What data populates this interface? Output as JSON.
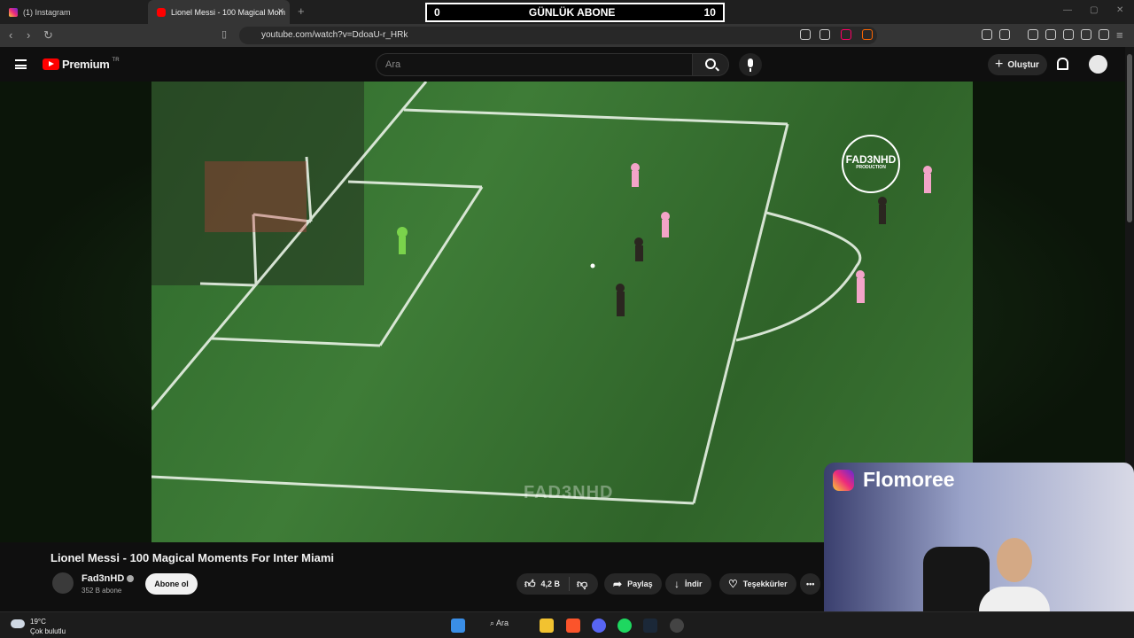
{
  "browser": {
    "tabs": [
      {
        "label": "(1) Instagram"
      },
      {
        "label": "Lionel Messi - 100 Magical Mom"
      }
    ],
    "url": "youtube.com/watch?v=DdoaU-r_HRk"
  },
  "overlay": {
    "left_value": "0",
    "title": "GÜNLÜK ABONE",
    "right_value": "10"
  },
  "youtube": {
    "logo_text": "Premium",
    "country_code": "TR",
    "search_placeholder": "Ara",
    "create_label": "Oluştur"
  },
  "video": {
    "watermark": "FAD3NHD",
    "badge_title": "FAD3NHD",
    "badge_sub": "PRODUCTION",
    "title": "Lionel Messi - 100 Magical Moments For Inter Miami",
    "channel": "Fad3nHD",
    "subscribers": "352 B abone",
    "subscribe_label": "Abone ol",
    "likes": "4,2 B",
    "share_label": "Paylaş",
    "download_label": "İndir",
    "thanks_label": "Teşekkürler",
    "more_label": "•••"
  },
  "webcam": {
    "instagram_handle": "Flomoree"
  },
  "taskbar": {
    "temperature": "19°C",
    "weather": "Çok bulutlu",
    "search_label": "Ara"
  }
}
